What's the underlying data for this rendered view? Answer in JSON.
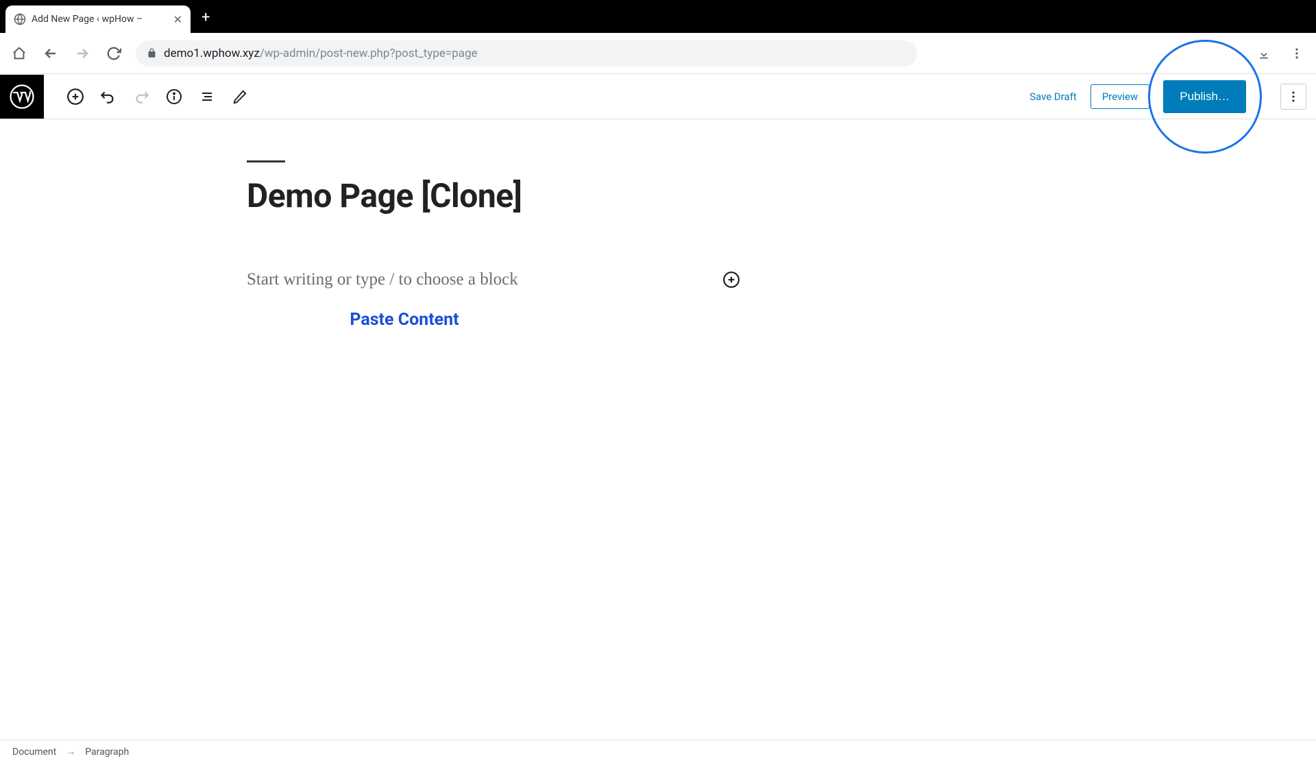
{
  "browser": {
    "tab_title": "Add New Page ‹ wpHow –",
    "url_domain": "demo1.wphow.xyz",
    "url_path": "/wp-admin/post-new.php?post_type=page"
  },
  "toolbar": {
    "save_draft_label": "Save Draft",
    "preview_label": "Preview",
    "publish_label": "Publish…"
  },
  "editor": {
    "page_title": "Demo Page [Clone]",
    "placeholder": "Start writing or type / to choose a block",
    "paste_label": "Paste Content"
  },
  "footer": {
    "crumb1": "Document",
    "crumb2": "Paragraph"
  }
}
